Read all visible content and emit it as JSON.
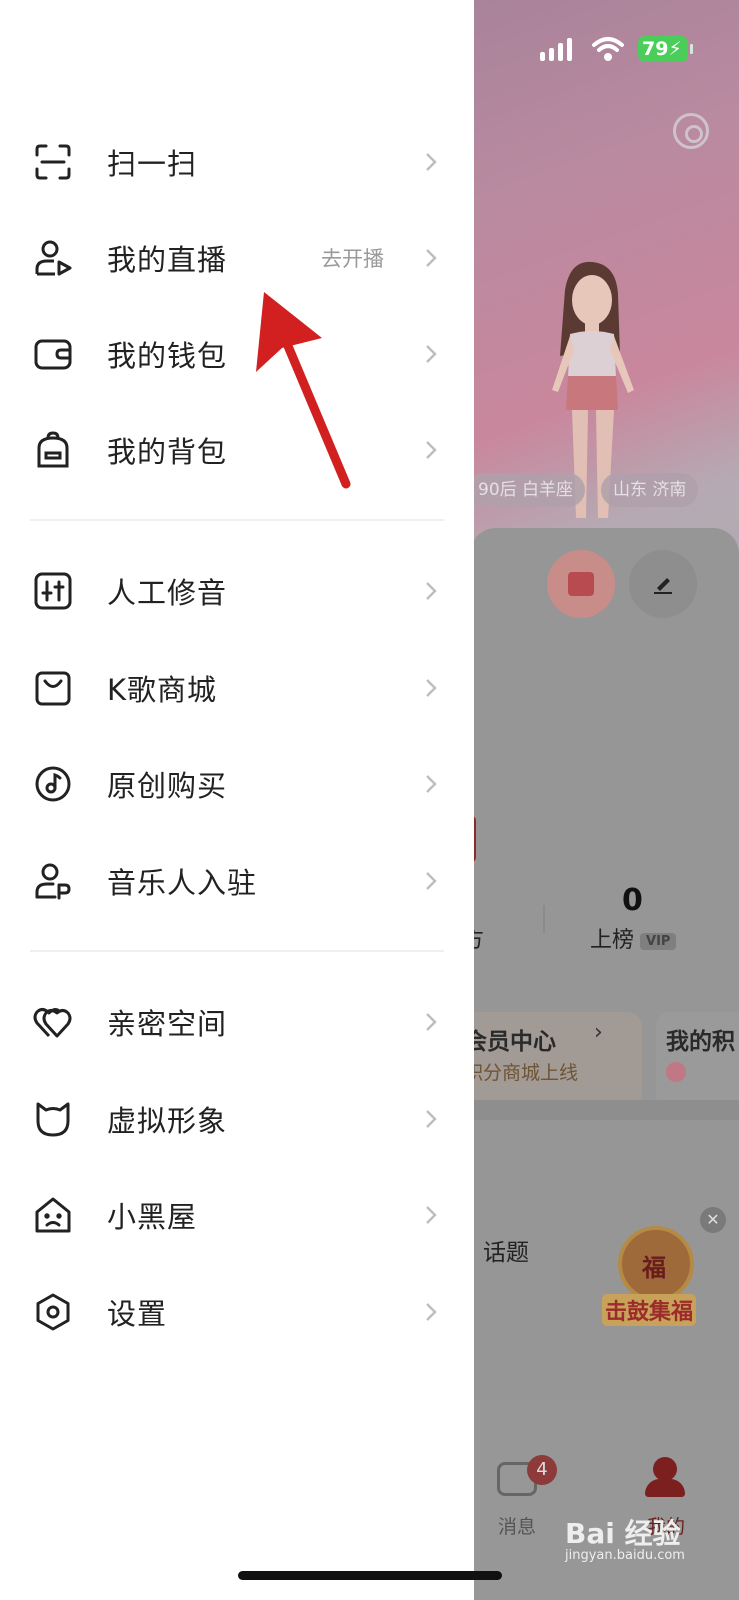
{
  "status_bar": {
    "battery": "79"
  },
  "menu": {
    "items": [
      {
        "label": "扫一扫",
        "icon": "scan-icon"
      },
      {
        "label": "我的直播",
        "sub": "去开播",
        "icon": "live-user-icon"
      },
      {
        "label": "我的钱包",
        "icon": "wallet-icon"
      },
      {
        "label": "我的背包",
        "icon": "backpack-icon"
      },
      {
        "label": "人工修音",
        "icon": "equalizer-icon"
      },
      {
        "label": "K歌商城",
        "icon": "shopping-bag-icon"
      },
      {
        "label": "原创购买",
        "icon": "music-disc-icon"
      },
      {
        "label": "音乐人入驻",
        "icon": "musician-icon"
      },
      {
        "label": "亲密空间",
        "icon": "hearts-icon"
      },
      {
        "label": "虚拟形象",
        "icon": "cat-face-icon"
      },
      {
        "label": "小黑屋",
        "icon": "sad-house-icon"
      },
      {
        "label": "设置",
        "icon": "settings-hex-icon"
      }
    ]
  },
  "background": {
    "tags": [
      "90后 白羊座",
      "山东 济南"
    ],
    "stat_value": "0",
    "stat_label": "上榜",
    "stat_left_fragment": "方",
    "vip_badge": "VIP",
    "vip_card_title": "会员中心",
    "vip_card_sub": "积分商城上线",
    "second_card_title": "我的积",
    "topic_label": "话题",
    "promo_text": "击鼓集福",
    "nav_badge": "4",
    "nav_messages": "消息",
    "nav_me": "我的",
    "watermark": "Bai 经验",
    "watermark_url": "jingyan.baidu.com"
  },
  "colors": {
    "annotation_arrow": "#d21f1f",
    "battery": "#4bcd5a"
  }
}
